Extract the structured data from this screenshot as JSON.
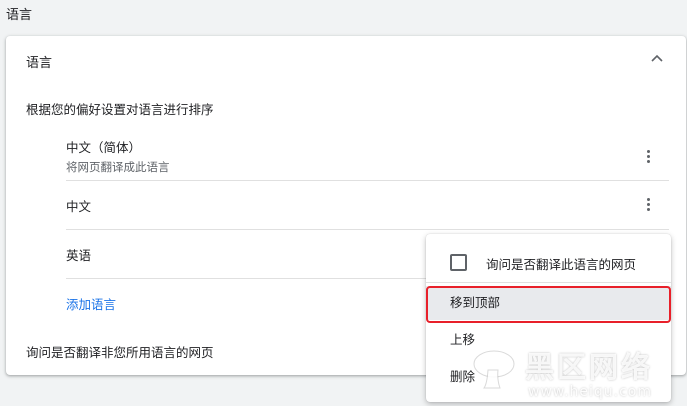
{
  "section": {
    "title": "语言"
  },
  "card": {
    "header": "语言",
    "hint": "根据您的偏好设置对语言进行排序",
    "languages": [
      {
        "name": "中文（简体）",
        "sub": "将网页翻译成此语言"
      },
      {
        "name": "中文",
        "sub": ""
      },
      {
        "name": "英语",
        "sub": ""
      }
    ],
    "add_language": "添加语言",
    "bottom_text": "询问是否翻译非您所用语言的网页"
  },
  "menu": {
    "checkbox_label": "询问是否翻译此语言的网页",
    "items": [
      "移到顶部",
      "上移",
      "删除"
    ]
  },
  "watermark": {
    "text": "黑区网络",
    "url": "www.heiqu.com"
  },
  "colors": {
    "link": "#1a73e8",
    "highlight": "#e8202a",
    "background": "#f1f3f4"
  }
}
